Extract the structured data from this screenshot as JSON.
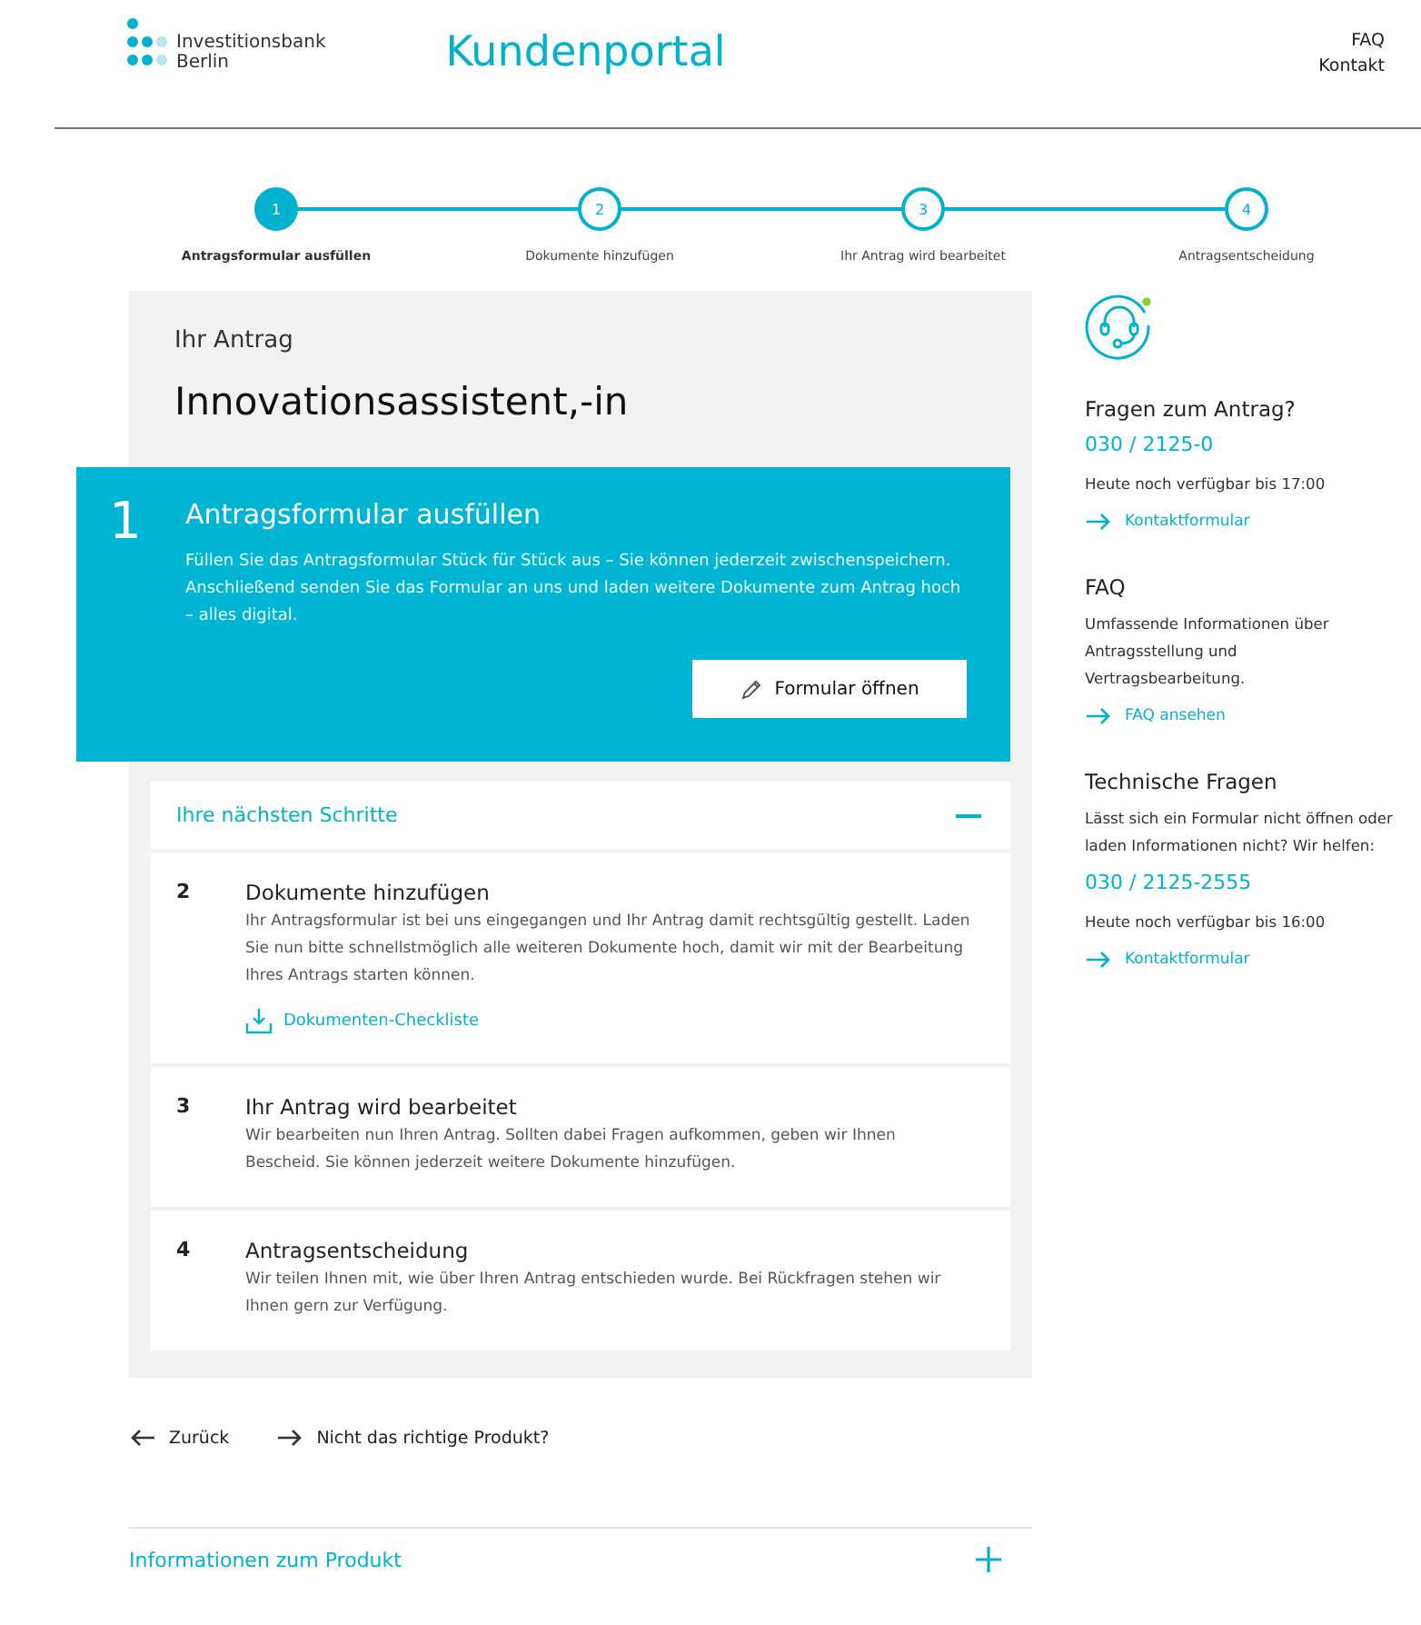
{
  "header": {
    "logo_line_1": "Investitionsbank",
    "logo_line_2": "Berlin",
    "title": "Kundenportal",
    "links": [
      "FAQ",
      "Kontakt"
    ]
  },
  "progress": [
    {
      "number": "1",
      "label": "Antragsformular ausfüllen",
      "selected": true
    },
    {
      "number": "2",
      "label": "Dokumente hinzufügen",
      "selected": false
    },
    {
      "number": "3",
      "label": "Ihr Antrag wird bearbeitet",
      "selected": false
    },
    {
      "number": "4",
      "label": "Antragsentscheidung",
      "selected": false
    }
  ],
  "application": {
    "eyebrow": "Ihr Antrag",
    "title": "Innovationsassistent,-in"
  },
  "current_step": {
    "number": "1",
    "title": "Antragsformular ausfüllen",
    "text": "Füllen Sie das Antragsformular Stück für Stück aus – Sie können jederzeit zwischenspeichern. Anschließend senden Sie das Formular an uns und laden weitere Dokumente zum Antrag hoch – alles digital.",
    "button": "Formular öffnen"
  },
  "next_steps": {
    "title": "Ihre nächsten Schritte",
    "expanded": true,
    "items": [
      {
        "number": "2",
        "title": "Dokumente hinzufügen",
        "text": "Ihr Antragsformular ist bei uns eingegangen und Ihr Antrag damit rechtsgültig gestellt. Laden Sie nun bitte schnellstmöglich alle weiteren Dokumente hoch, damit wir mit der Bearbeitung Ihres Antrags starten können.",
        "link": "Dokumenten-Checkliste"
      },
      {
        "number": "3",
        "title": "Ihr Antrag wird bearbeitet",
        "text": "Wir bearbeiten nun Ihren Antrag. Sollten dabei Fragen aufkommen, geben wir Ihnen Bescheid. Sie können jederzeit weitere Dokumente hinzufügen."
      },
      {
        "number": "4",
        "title": "Antragsentscheidung",
        "text": "Wir teilen Ihnen mit, wie über Ihren Antrag entschieden wurde. Bei Rückfragen stehen wir Ihnen gern zur Verfügung."
      }
    ]
  },
  "nav_links": [
    {
      "kind": "back",
      "label": "Zurück"
    },
    {
      "kind": "forward",
      "label": "Nicht das richtige Produkt?"
    }
  ],
  "product_info": {
    "title": "Informationen zum Produkt",
    "expanded": false
  },
  "sidebar": [
    {
      "title": "Fragen zum Antrag?",
      "phone": "030 / 2125-0",
      "availability": "Heute noch verfügbar bis 17:00",
      "link": "Kontaktformular"
    },
    {
      "title": "FAQ",
      "text": "Umfassende Informationen über Antragsstellung und Vertragsbearbeitung.",
      "link": "FAQ ansehen"
    },
    {
      "title": "Technische Fragen",
      "text": "Lässt sich ein Formular nicht öffnen oder laden Informationen nicht? Wir helfen:",
      "phone": "030 / 2125-2555",
      "availability": "Heute noch verfügbar bis 16:00",
      "link": "Kontaktformular"
    }
  ]
}
